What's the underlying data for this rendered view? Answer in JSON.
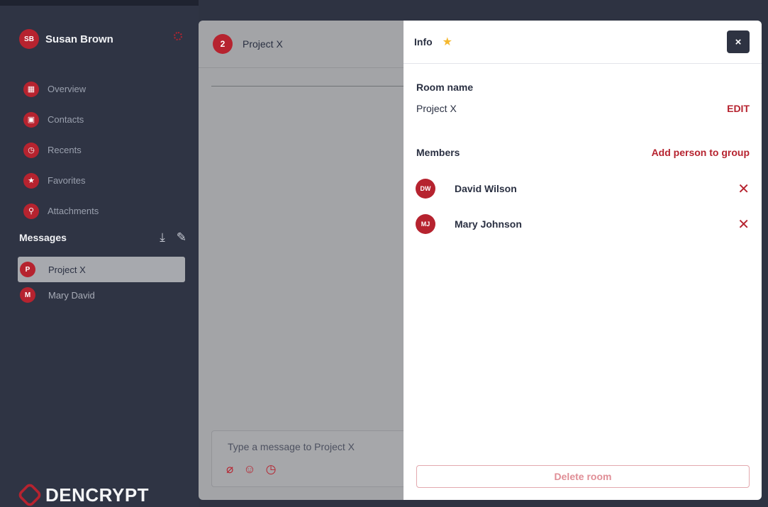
{
  "user": {
    "initials": "SB",
    "name": "Susan Brown"
  },
  "nav": [
    {
      "icon": "grid-icon",
      "glyph": "▦",
      "label": "Overview"
    },
    {
      "icon": "contacts-icon",
      "glyph": "▣",
      "label": "Contacts"
    },
    {
      "icon": "clock-icon",
      "glyph": "◷",
      "label": "Recents"
    },
    {
      "icon": "star-icon",
      "glyph": "★",
      "label": "Favorites"
    },
    {
      "icon": "search-icon",
      "glyph": "⚲",
      "label": "Attachments"
    }
  ],
  "messages": {
    "title": "Messages",
    "rooms": [
      {
        "initial": "P",
        "label": "Project X",
        "active": true
      },
      {
        "initial": "M",
        "label": "Mary David",
        "active": false
      }
    ]
  },
  "logo": {
    "text": "DENCRYPT"
  },
  "chat": {
    "badge": "2",
    "title": "Project X",
    "placeholder": "Type a message to Project X"
  },
  "info": {
    "title": "Info",
    "close_label": "×",
    "room_name_label": "Room name",
    "room_name_value": "Project X",
    "edit_label": "EDIT",
    "members_label": "Members",
    "add_person_label": "Add person to group",
    "members": [
      {
        "initials": "DW",
        "name": "David Wilson"
      },
      {
        "initials": "MJ",
        "name": "Mary Johnson"
      }
    ],
    "delete_label": "Delete room"
  },
  "colors": {
    "accent": "#b6232f",
    "sidebar": "#2f3444",
    "star": "#f5b82e"
  }
}
